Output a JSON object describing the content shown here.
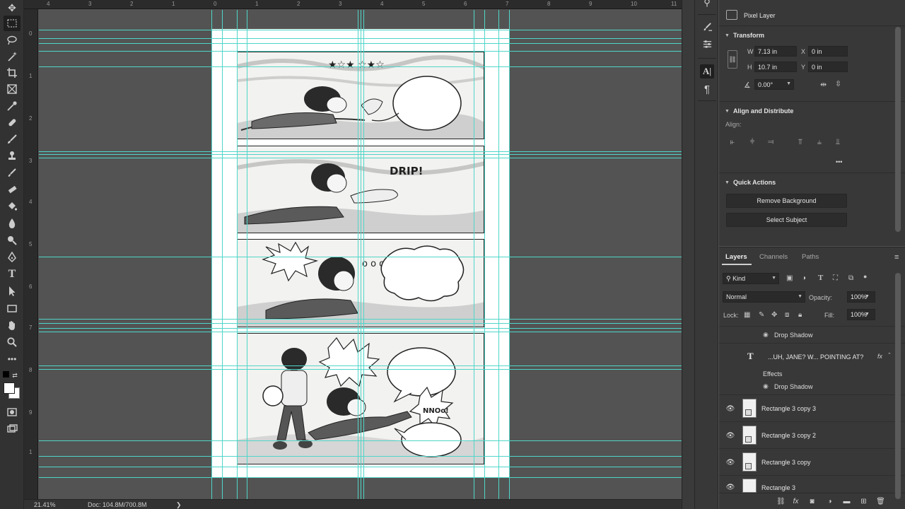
{
  "statusbar": {
    "zoom": "21.41%",
    "doc": "Doc: 104.8M/700.8M",
    "arrow": "❯"
  },
  "rulers": {
    "top": [
      "4",
      "3",
      "2",
      "1",
      "0",
      "1",
      "2",
      "3",
      "4",
      "5",
      "6",
      "7",
      "8",
      "9",
      "10",
      "11"
    ],
    "left": [
      "0",
      "1",
      "2",
      "3",
      "4",
      "5",
      "6",
      "7",
      "8",
      "9",
      "1"
    ]
  },
  "comic": {
    "sfx_stars": "★ ☆ ★\n☆ ★ ☆",
    "sfx_drip": "DRIP!",
    "sfx_noo": "NNOo!",
    "thought_dots": "o o o"
  },
  "properties": {
    "layer_kind": "Pixel Layer",
    "transform_title": "Transform",
    "w_label": "W",
    "w_value": "7.13 in",
    "h_label": "H",
    "h_value": "10.7 in",
    "x_label": "X",
    "x_value": "0 in",
    "y_label": "Y",
    "y_value": "0 in",
    "angle_value": "0.00°",
    "align_title": "Align and Distribute",
    "align_label": "Align:",
    "more": "•••",
    "quick_title": "Quick Actions",
    "remove_bg": "Remove Background",
    "select_subject": "Select Subject"
  },
  "layers": {
    "tabs": [
      "Layers",
      "Channels",
      "Paths"
    ],
    "kind": "Kind",
    "blend_mode": "Normal",
    "opacity_label": "Opacity:",
    "opacity_value": "100%",
    "lock_label": "Lock:",
    "fill_label": "Fill:",
    "fill_value": "100%",
    "top_effect": "Drop Shadow",
    "text_layer_name": "...UH, JANE? W... POINTING AT?",
    "fx": "fx",
    "effects_label": "Effects",
    "effect_drop_shadow": "Drop Shadow",
    "rows": [
      {
        "name": "Rectangle 3 copy 3"
      },
      {
        "name": "Rectangle 3 copy 2"
      },
      {
        "name": "Rectangle 3 copy"
      },
      {
        "name": "Rectangle 3"
      }
    ]
  },
  "colors": {
    "guide": "#4fd6c8",
    "ui_dark": "#323232",
    "panel_bg": "#383838",
    "canvas_bg": "#535353"
  }
}
